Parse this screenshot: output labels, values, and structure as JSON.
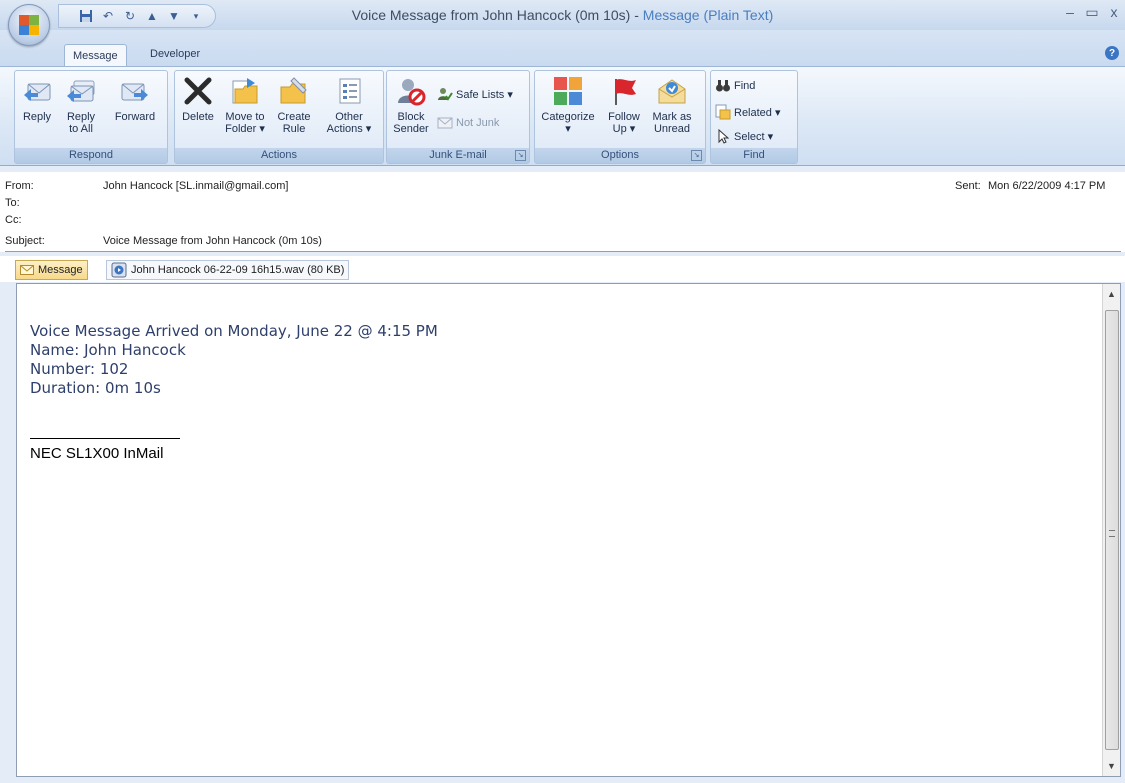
{
  "window": {
    "title_main": "Voice Message from John Hancock (0m 10s)",
    "title_separator": " - ",
    "title_suffix": "Message (Plain Text)"
  },
  "controls": {
    "minimize": "–",
    "maximize": "▭",
    "close": "x"
  },
  "tabs": [
    {
      "label": "Message",
      "active": true
    },
    {
      "label": "Developer",
      "active": false
    }
  ],
  "ribbon": {
    "groups": {
      "respond": "Respond",
      "actions": "Actions",
      "junk": "Junk E-mail",
      "options": "Options",
      "find": "Find"
    },
    "buttons": {
      "reply": "Reply",
      "reply_all_1": "Reply",
      "reply_all_2": "to All",
      "forward": "Forward",
      "delete": "Delete",
      "move_1": "Move to",
      "move_2": "Folder ▾",
      "create_1": "Create",
      "create_2": "Rule",
      "other_1": "Other",
      "other_2": "Actions ▾",
      "block_1": "Block",
      "block_2": "Sender",
      "safe_lists": "Safe Lists ▾",
      "not_junk": "Not Junk",
      "categorize": "Categorize",
      "categorize_arrow": "▾",
      "follow_1": "Follow",
      "follow_2": "Up ▾",
      "mark_1": "Mark as",
      "mark_2": "Unread",
      "find": "Find",
      "related": "Related ▾",
      "select": "Select ▾"
    }
  },
  "header": {
    "from_label": "From:",
    "from_name": "John Hancock",
    "from_email": "[SL.inmail@gmail.com]",
    "to_label": "To:",
    "cc_label": "Cc:",
    "subject_label": "Subject:",
    "subject": "Voice Message from John Hancock (0m 10s)",
    "sent_label": "Sent:",
    "sent": "Mon 6/22/2009 4:17 PM"
  },
  "attachments": {
    "message": "Message",
    "file": "John Hancock 06-22-09 16h15.wav (80 KB)"
  },
  "body": {
    "line1": "Voice Message Arrived on Monday, June 22 @ 4:15 PM",
    "line2": "Name: John Hancock",
    "line3": "Number: 102",
    "line4": "Duration: 0m 10s",
    "signature": "NEC SL1X00 InMail"
  },
  "colors": {
    "accent_blue": "#4a7ec0",
    "ribbon_label": "#35507a",
    "flag_red": "#d8262c"
  }
}
